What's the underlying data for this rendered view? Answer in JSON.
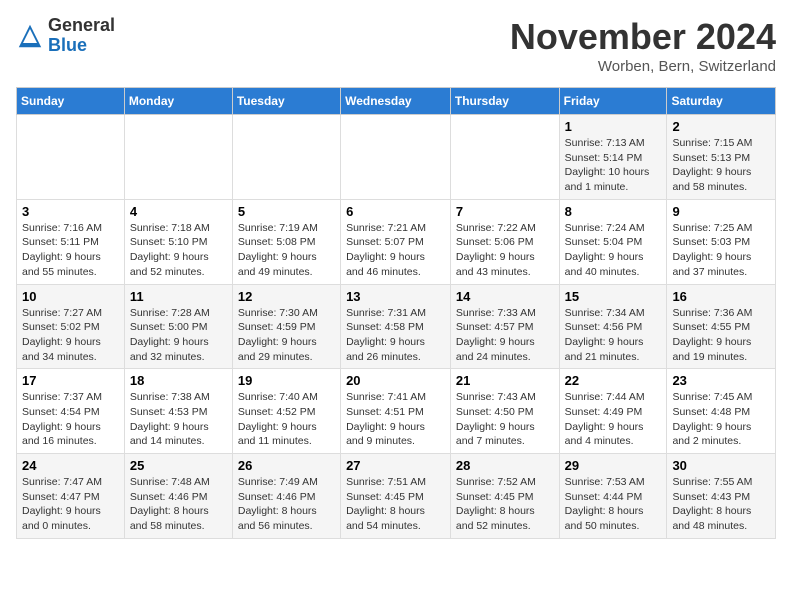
{
  "logo": {
    "general": "General",
    "blue": "Blue"
  },
  "title": "November 2024",
  "location": "Worben, Bern, Switzerland",
  "days_of_week": [
    "Sunday",
    "Monday",
    "Tuesday",
    "Wednesday",
    "Thursday",
    "Friday",
    "Saturday"
  ],
  "weeks": [
    [
      {
        "day": "",
        "info": ""
      },
      {
        "day": "",
        "info": ""
      },
      {
        "day": "",
        "info": ""
      },
      {
        "day": "",
        "info": ""
      },
      {
        "day": "",
        "info": ""
      },
      {
        "day": "1",
        "info": "Sunrise: 7:13 AM\nSunset: 5:14 PM\nDaylight: 10 hours and 1 minute."
      },
      {
        "day": "2",
        "info": "Sunrise: 7:15 AM\nSunset: 5:13 PM\nDaylight: 9 hours and 58 minutes."
      }
    ],
    [
      {
        "day": "3",
        "info": "Sunrise: 7:16 AM\nSunset: 5:11 PM\nDaylight: 9 hours and 55 minutes."
      },
      {
        "day": "4",
        "info": "Sunrise: 7:18 AM\nSunset: 5:10 PM\nDaylight: 9 hours and 52 minutes."
      },
      {
        "day": "5",
        "info": "Sunrise: 7:19 AM\nSunset: 5:08 PM\nDaylight: 9 hours and 49 minutes."
      },
      {
        "day": "6",
        "info": "Sunrise: 7:21 AM\nSunset: 5:07 PM\nDaylight: 9 hours and 46 minutes."
      },
      {
        "day": "7",
        "info": "Sunrise: 7:22 AM\nSunset: 5:06 PM\nDaylight: 9 hours and 43 minutes."
      },
      {
        "day": "8",
        "info": "Sunrise: 7:24 AM\nSunset: 5:04 PM\nDaylight: 9 hours and 40 minutes."
      },
      {
        "day": "9",
        "info": "Sunrise: 7:25 AM\nSunset: 5:03 PM\nDaylight: 9 hours and 37 minutes."
      }
    ],
    [
      {
        "day": "10",
        "info": "Sunrise: 7:27 AM\nSunset: 5:02 PM\nDaylight: 9 hours and 34 minutes."
      },
      {
        "day": "11",
        "info": "Sunrise: 7:28 AM\nSunset: 5:00 PM\nDaylight: 9 hours and 32 minutes."
      },
      {
        "day": "12",
        "info": "Sunrise: 7:30 AM\nSunset: 4:59 PM\nDaylight: 9 hours and 29 minutes."
      },
      {
        "day": "13",
        "info": "Sunrise: 7:31 AM\nSunset: 4:58 PM\nDaylight: 9 hours and 26 minutes."
      },
      {
        "day": "14",
        "info": "Sunrise: 7:33 AM\nSunset: 4:57 PM\nDaylight: 9 hours and 24 minutes."
      },
      {
        "day": "15",
        "info": "Sunrise: 7:34 AM\nSunset: 4:56 PM\nDaylight: 9 hours and 21 minutes."
      },
      {
        "day": "16",
        "info": "Sunrise: 7:36 AM\nSunset: 4:55 PM\nDaylight: 9 hours and 19 minutes."
      }
    ],
    [
      {
        "day": "17",
        "info": "Sunrise: 7:37 AM\nSunset: 4:54 PM\nDaylight: 9 hours and 16 minutes."
      },
      {
        "day": "18",
        "info": "Sunrise: 7:38 AM\nSunset: 4:53 PM\nDaylight: 9 hours and 14 minutes."
      },
      {
        "day": "19",
        "info": "Sunrise: 7:40 AM\nSunset: 4:52 PM\nDaylight: 9 hours and 11 minutes."
      },
      {
        "day": "20",
        "info": "Sunrise: 7:41 AM\nSunset: 4:51 PM\nDaylight: 9 hours and 9 minutes."
      },
      {
        "day": "21",
        "info": "Sunrise: 7:43 AM\nSunset: 4:50 PM\nDaylight: 9 hours and 7 minutes."
      },
      {
        "day": "22",
        "info": "Sunrise: 7:44 AM\nSunset: 4:49 PM\nDaylight: 9 hours and 4 minutes."
      },
      {
        "day": "23",
        "info": "Sunrise: 7:45 AM\nSunset: 4:48 PM\nDaylight: 9 hours and 2 minutes."
      }
    ],
    [
      {
        "day": "24",
        "info": "Sunrise: 7:47 AM\nSunset: 4:47 PM\nDaylight: 9 hours and 0 minutes."
      },
      {
        "day": "25",
        "info": "Sunrise: 7:48 AM\nSunset: 4:46 PM\nDaylight: 8 hours and 58 minutes."
      },
      {
        "day": "26",
        "info": "Sunrise: 7:49 AM\nSunset: 4:46 PM\nDaylight: 8 hours and 56 minutes."
      },
      {
        "day": "27",
        "info": "Sunrise: 7:51 AM\nSunset: 4:45 PM\nDaylight: 8 hours and 54 minutes."
      },
      {
        "day": "28",
        "info": "Sunrise: 7:52 AM\nSunset: 4:45 PM\nDaylight: 8 hours and 52 minutes."
      },
      {
        "day": "29",
        "info": "Sunrise: 7:53 AM\nSunset: 4:44 PM\nDaylight: 8 hours and 50 minutes."
      },
      {
        "day": "30",
        "info": "Sunrise: 7:55 AM\nSunset: 4:43 PM\nDaylight: 8 hours and 48 minutes."
      }
    ]
  ]
}
